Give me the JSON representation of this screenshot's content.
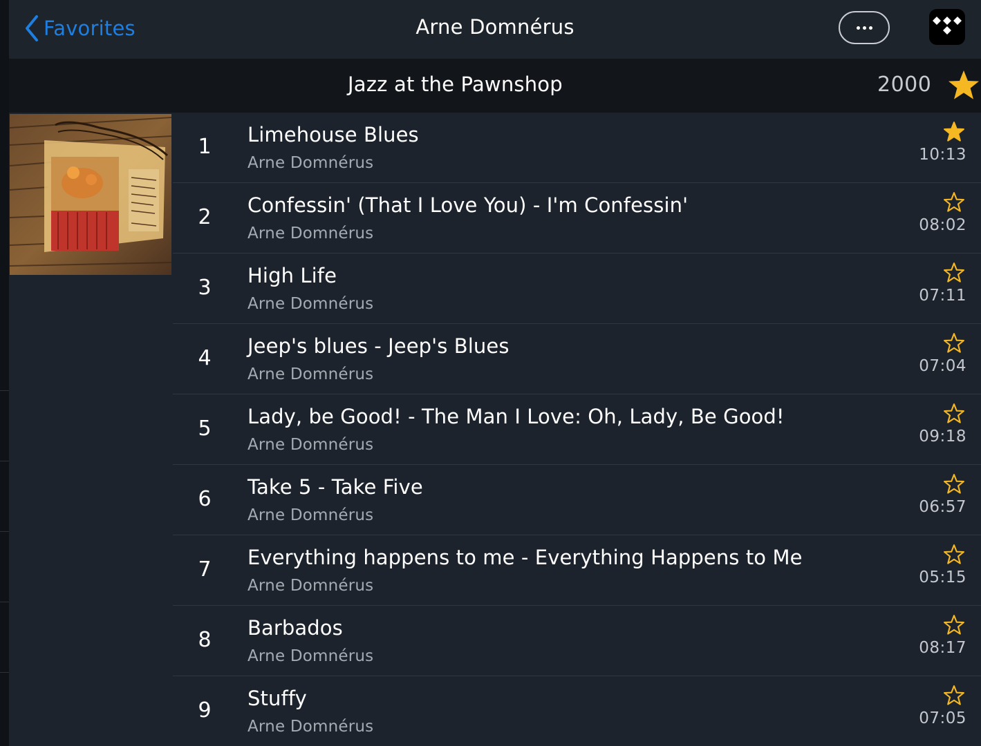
{
  "nav": {
    "back_label": "Favorites",
    "title": "Arne Domnérus"
  },
  "album": {
    "title": "Jazz at the Pawnshop",
    "year": "2000",
    "favorited": true
  },
  "icons": {
    "back": "chevron-left-icon",
    "more": "ellipsis-icon",
    "service": "tidal-logo-icon",
    "favorite": "star-icon"
  },
  "colors": {
    "accent": "#1e7fe0",
    "star": "#f5b722",
    "background": "#1c232c",
    "album_bar": "#12161b"
  },
  "tracks": [
    {
      "number": "1",
      "title": "Limehouse Blues",
      "artist": "Arne Domnérus",
      "duration": "10:13",
      "favorited": true
    },
    {
      "number": "2",
      "title": "Confessin' (That I Love You) - I'm Confessin'",
      "artist": "Arne Domnérus",
      "duration": "08:02",
      "favorited": false
    },
    {
      "number": "3",
      "title": "High Life",
      "artist": "Arne Domnérus",
      "duration": "07:11",
      "favorited": false
    },
    {
      "number": "4",
      "title": "Jeep's blues - Jeep's Blues",
      "artist": "Arne Domnérus",
      "duration": "07:04",
      "favorited": false
    },
    {
      "number": "5",
      "title": "Lady, be Good! - The Man I Love: Oh, Lady, Be Good!",
      "artist": "Arne Domnérus",
      "duration": "09:18",
      "favorited": false
    },
    {
      "number": "6",
      "title": "Take 5 - Take Five",
      "artist": "Arne Domnérus",
      "duration": "06:57",
      "favorited": false
    },
    {
      "number": "7",
      "title": "Everything happens to me - Everything Happens to Me",
      "artist": "Arne Domnérus",
      "duration": "05:15",
      "favorited": false
    },
    {
      "number": "8",
      "title": "Barbados",
      "artist": "Arne Domnérus",
      "duration": "08:17",
      "favorited": false
    },
    {
      "number": "9",
      "title": "Stuffy",
      "artist": "Arne Domnérus",
      "duration": "07:05",
      "favorited": false
    }
  ]
}
